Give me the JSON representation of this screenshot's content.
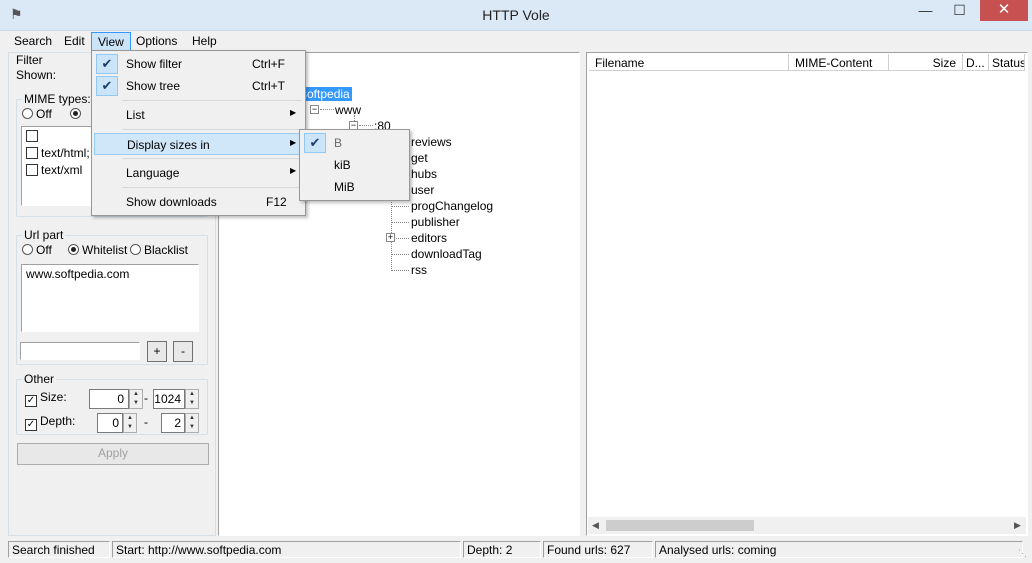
{
  "window": {
    "title": "HTTP Vole",
    "minimize": "—",
    "maximize": "☐",
    "close": "✕"
  },
  "menubar": [
    "Search",
    "Edit",
    "View",
    "Options",
    "Help"
  ],
  "filter": {
    "title": "Filter",
    "shown_label": "Shown:",
    "mime_types": {
      "title": "MIME types:",
      "off": "Off",
      "items": [
        "",
        "text/html;",
        "text/xml"
      ]
    },
    "url_part": {
      "title": "Url part",
      "off": "Off",
      "whitelist": "Whitelist",
      "blacklist": "Blacklist",
      "entries": [
        "www.softpedia.com"
      ],
      "add": "+",
      "remove": "-"
    },
    "other": {
      "title": "Other",
      "size_label": "Size:",
      "size_min": "0",
      "size_max": "1024",
      "depth_label": "Depth:",
      "depth_min": "0",
      "depth_max": "2",
      "dash": "-"
    },
    "apply": "Apply"
  },
  "tree": {
    "root": "softpedia",
    "www": "www",
    "port": ":80",
    "children": [
      "reviews",
      "get",
      "hubs",
      "user",
      "progChangelog",
      "publisher",
      "editors",
      "downloadTag",
      "rss"
    ]
  },
  "table": {
    "columns": [
      "Filename",
      "MIME-Content",
      "Size",
      "D...",
      "Status"
    ]
  },
  "view_menu": {
    "items": [
      {
        "label": "Show filter",
        "shortcut": "Ctrl+F",
        "checked": true
      },
      {
        "label": "Show tree",
        "shortcut": "Ctrl+T",
        "checked": true
      },
      {
        "label": "List",
        "submenu": true
      },
      {
        "label": "Display sizes in",
        "submenu": true
      },
      {
        "label": "Language",
        "submenu": true
      },
      {
        "label": "Show downloads",
        "shortcut": "F12"
      }
    ]
  },
  "sizes_submenu": {
    "items": [
      "B",
      "kiB",
      "MiB"
    ],
    "selected": "B"
  },
  "status": {
    "state": "Search finished",
    "start": "Start: http://www.softpedia.com",
    "depth": "Depth: 2",
    "found": "Found urls: 627",
    "analysed": "Analysed urls: coming"
  },
  "colors": {
    "selection": "#3399ff",
    "menu_highlight": "#cce4f7",
    "close": "#c75050"
  }
}
